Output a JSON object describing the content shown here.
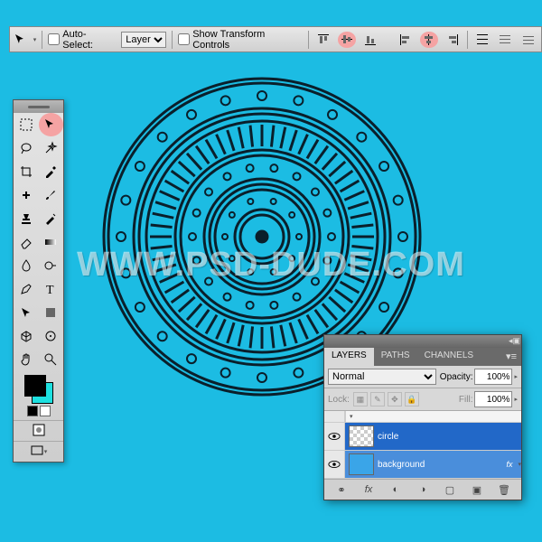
{
  "watermark": "WWW.PSD-DUDE.COM",
  "options": {
    "auto_select": "Auto-Select:",
    "layer_dropdown": "Layer",
    "show_transform": "Show Transform Controls"
  },
  "layers_panel": {
    "tabs": [
      "LAYERS",
      "PATHS",
      "CHANNELS"
    ],
    "blend_mode": "Normal",
    "opacity_label": "Opacity:",
    "opacity_value": "100%",
    "lock_label": "Lock:",
    "fill_label": "Fill:",
    "fill_value": "100%",
    "layers": [
      {
        "name": "circle",
        "selected": true,
        "thumb": "checker"
      },
      {
        "name": "background",
        "selected": false,
        "thumb": "bgc",
        "fx": "fx"
      }
    ]
  },
  "colors": {
    "fg": "#000000",
    "bg": "#1de0e0"
  }
}
